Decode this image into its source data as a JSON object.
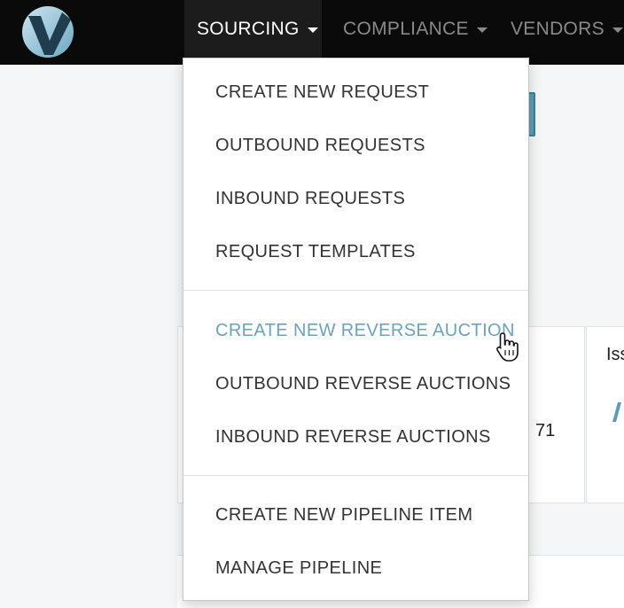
{
  "navbar": {
    "logo_icon": "v-logo-icon",
    "items": [
      {
        "label": "SOURCING",
        "active": true
      },
      {
        "label": "COMPLIANCE",
        "active": false
      },
      {
        "label": "VENDORS",
        "active": false
      }
    ]
  },
  "dropdown": {
    "groups": [
      [
        "CREATE NEW REQUEST",
        "OUTBOUND REQUESTS",
        "INBOUND REQUESTS",
        "REQUEST TEMPLATES"
      ],
      [
        "CREATE NEW REVERSE AUCTION",
        "OUTBOUND REVERSE AUCTIONS",
        "INBOUND REVERSE AUCTIONS"
      ],
      [
        "CREATE NEW PIPELINE ITEM",
        "MANAGE PIPELINE"
      ]
    ],
    "hovered_item": "CREATE NEW REVERSE AUCTION"
  },
  "background": {
    "card_value": "71",
    "card_title_partial": "Iss"
  },
  "colors": {
    "navbar_bg": "#0a0a0a",
    "active_tab_bg": "#1c1c1c",
    "hover_text": "#6aa3bb",
    "menu_text": "#333333"
  }
}
